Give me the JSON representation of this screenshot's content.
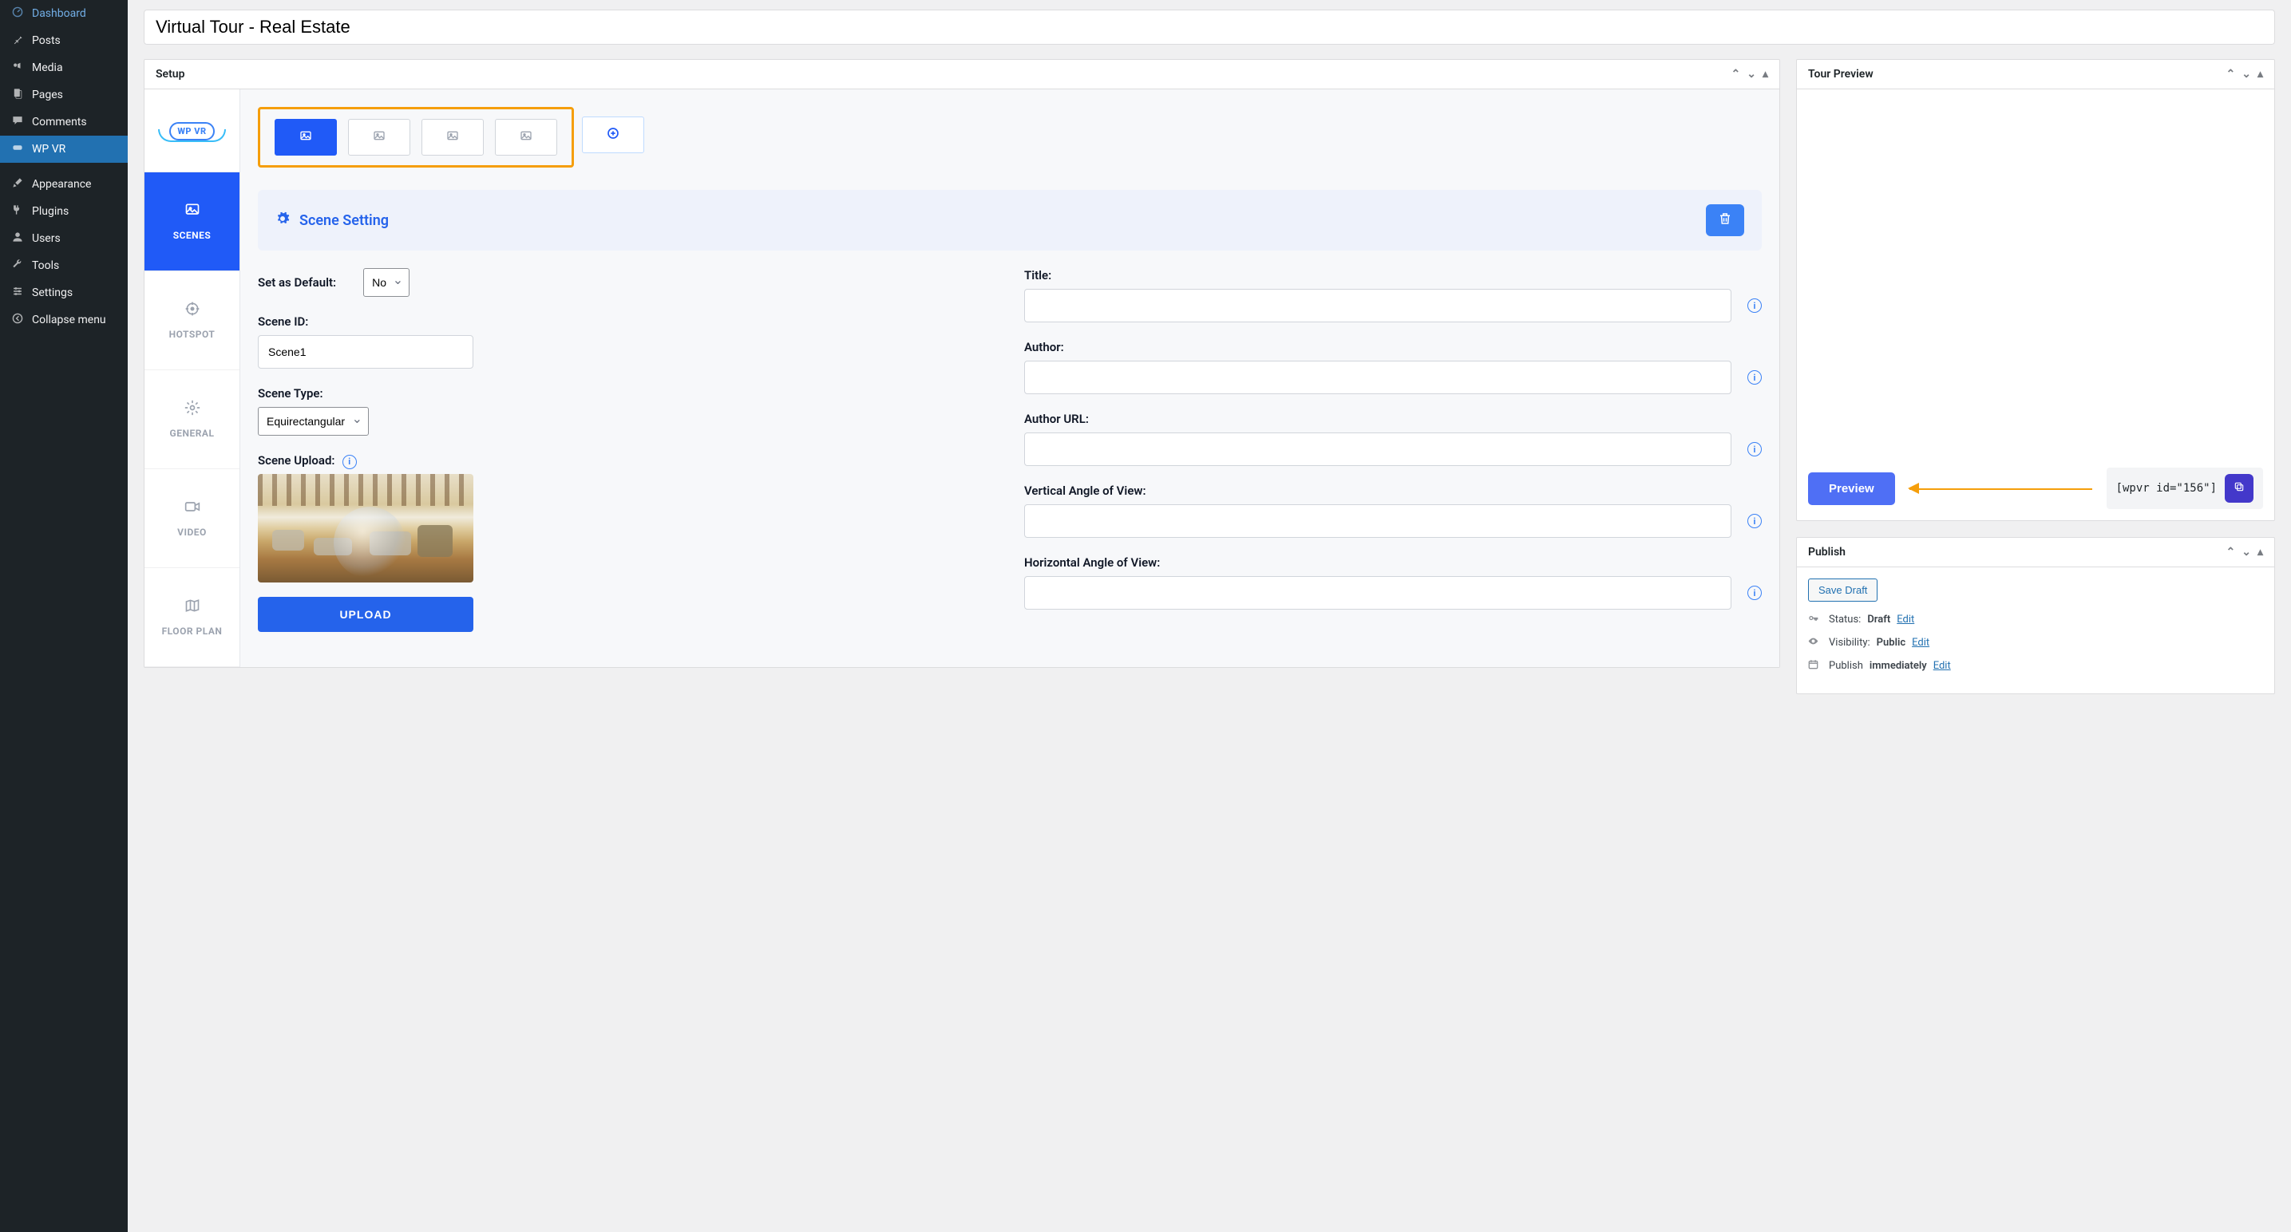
{
  "sidebar": {
    "items": [
      {
        "icon": "dashboard",
        "label": "Dashboard"
      },
      {
        "icon": "pin",
        "label": "Posts"
      },
      {
        "icon": "media",
        "label": "Media"
      },
      {
        "icon": "pages",
        "label": "Pages"
      },
      {
        "icon": "comments",
        "label": "Comments"
      },
      {
        "icon": "vr",
        "label": "WP VR",
        "active": true
      }
    ],
    "items2": [
      {
        "icon": "brush",
        "label": "Appearance"
      },
      {
        "icon": "plug",
        "label": "Plugins"
      },
      {
        "icon": "user",
        "label": "Users"
      },
      {
        "icon": "wrench",
        "label": "Tools"
      },
      {
        "icon": "sliders",
        "label": "Settings"
      },
      {
        "icon": "collapse",
        "label": "Collapse menu"
      }
    ]
  },
  "title": "Virtual Tour - Real Estate",
  "setup": {
    "header": "Setup",
    "logo_text": "WP VR",
    "tabs": [
      {
        "label": "SCENES",
        "icon": "image",
        "active": true
      },
      {
        "label": "HOTSPOT",
        "icon": "target"
      },
      {
        "label": "GENERAL",
        "icon": "gear"
      },
      {
        "label": "VIDEO",
        "icon": "video"
      },
      {
        "label": "FLOOR PLAN",
        "icon": "map"
      }
    ],
    "scene_setting_title": "Scene Setting",
    "form": {
      "set_default_label": "Set as Default:",
      "set_default_value": "No",
      "scene_id_label": "Scene ID:",
      "scene_id_value": "Scene1",
      "scene_type_label": "Scene Type:",
      "scene_type_value": "Equirectangular",
      "scene_upload_label": "Scene Upload:",
      "upload_btn": "UPLOAD",
      "title_label": "Title:",
      "author_label": "Author:",
      "author_url_label": "Author URL:",
      "vaov_label": "Vertical Angle of View:",
      "haov_label": "Horizontal Angle of View:"
    }
  },
  "preview": {
    "header": "Tour Preview",
    "button": "Preview",
    "shortcode": "[wpvr id=\"156\"]"
  },
  "publish": {
    "header": "Publish",
    "save_draft": "Save Draft",
    "status_label": "Status:",
    "status_value": "Draft",
    "visibility_label": "Visibility:",
    "visibility_value": "Public",
    "publish_label": "Publish",
    "publish_value": "immediately",
    "edit": "Edit"
  }
}
